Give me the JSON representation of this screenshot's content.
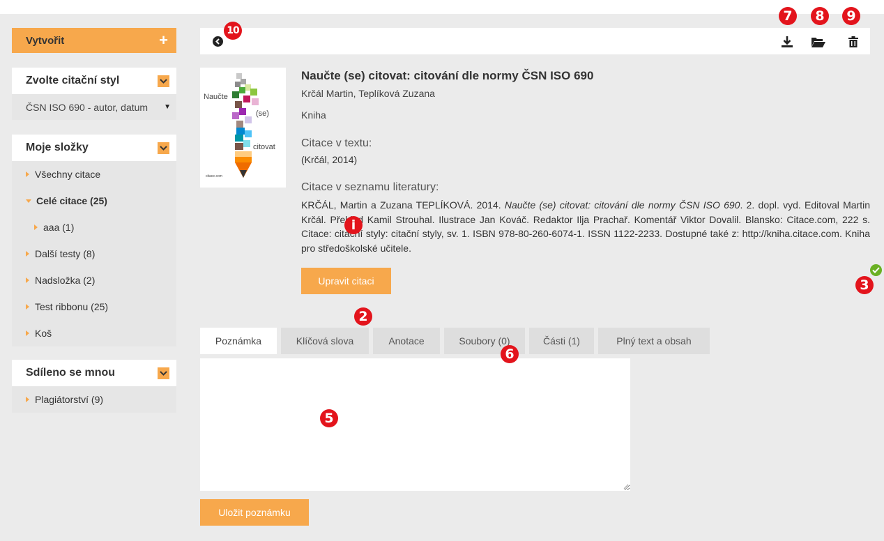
{
  "sidebar": {
    "create_label": "Vytvořit",
    "create_plus": "+",
    "style_panel": {
      "title": "Zvolte citační styl",
      "selected": "ČSN ISO 690 - autor, datum"
    },
    "folders_panel": {
      "title": "Moje složky",
      "items": [
        {
          "label": "Všechny citace",
          "expanded": false
        },
        {
          "label": "Celé citace (25)",
          "expanded": true
        },
        {
          "label": "aaa (1)",
          "expanded": false
        },
        {
          "label": "Další testy (8)",
          "expanded": false
        },
        {
          "label": "Nadsložka (2)",
          "expanded": false
        },
        {
          "label": "Test ribbonu (25)",
          "expanded": false
        },
        {
          "label": "Koš",
          "expanded": false
        }
      ]
    },
    "shared_panel": {
      "title": "Sdíleno se mnou",
      "items": [
        {
          "label": "Plagiátorství (9)"
        }
      ]
    }
  },
  "toolbar": {
    "icons": [
      "back-icon",
      "download-icon",
      "folder-open-icon",
      "trash-icon"
    ]
  },
  "cover": {
    "line1": "Naučte",
    "line2": "(se)",
    "line3": "citovat",
    "publisher": "citace.com"
  },
  "detail": {
    "title": "Naučte (se) citovat: citování dle normy ČSN ISO 690",
    "authors": "Krčál Martin, Teplíková Zuzana",
    "type": "Kniha",
    "in_text_label": "Citace v textu:",
    "in_text_value": "(Krčál, 2014)",
    "bib_label": "Citace v seznamu literatury:",
    "bib_part1": "KRČÁL, Martin a Zuzana TEPLÍKOVÁ. 2014. ",
    "bib_italic": "Naučte (se) citovat: citování dle normy ČSN ISO 690",
    "bib_part2": ". 2. dopl. vyd. Editoval Martin Krčál. Překlad Kamil Strouhal. Ilustrace Jan Kováč. Redaktor Ilja Prachař. Komentář Viktor Dovalil. Blansko: Citace.com, 222 s. Citace: citační styly: citační styly, sv. 1. ISBN 978-80-260-6074-1. ISSN 1122-2233. Dostupné také z: http://kniha.citace.com. Kniha pro středoškolské učitele.",
    "edit_button": "Upravit citaci"
  },
  "tabs": [
    {
      "label": "Poznámka",
      "active": true
    },
    {
      "label": "Klíčová slova",
      "active": false
    },
    {
      "label": "Anotace",
      "active": false
    },
    {
      "label": "Soubory (0)",
      "active": false
    },
    {
      "label": "Části (1)",
      "active": false
    },
    {
      "label": "Plný text a obsah",
      "active": false
    }
  ],
  "note": {
    "value": "",
    "save_button": "Uložit poznámku"
  },
  "badges": {
    "b1": "i",
    "b2": "2",
    "b3": "3",
    "b5": "5",
    "b6": "6",
    "b7": "7",
    "b8": "8",
    "b9": "9",
    "b10": "10"
  },
  "colors": {
    "accent": "#f7a84c",
    "badge": "#e3141c",
    "success": "#6ab023",
    "background": "#ebebeb"
  }
}
